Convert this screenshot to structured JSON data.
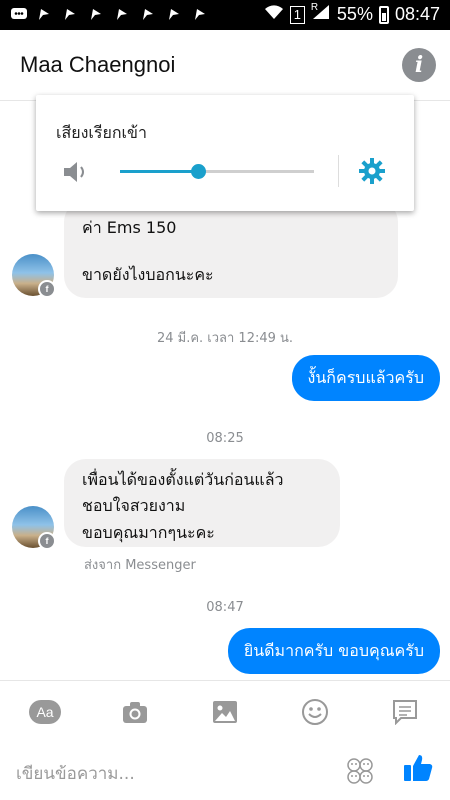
{
  "status_bar": {
    "battery": "55%",
    "time": "08:47",
    "sim_label": "1",
    "roaming": "R"
  },
  "header": {
    "title": "Maa Chaengnoi",
    "info_icon": "info-icon"
  },
  "volume_panel": {
    "title": "เสียงเรียกเข้า",
    "level_fraction": 0.4,
    "accent": "#1aa0cc"
  },
  "messages": [
    {
      "lines": [
        "ค่า Ems 150",
        "ขาดยังไงบอกนะคะ"
      ]
    },
    {
      "timestamp": "24 มี.ค. เวลา 12:49 น.",
      "text": "งั้นก็ครบแล้วครับ"
    },
    {
      "timestamp": "08:25",
      "lines": [
        "เพื่อนได้ของตั้งแต่วันก่อนแล้ว",
        "ชอบใจสวยงาม",
        "ขอบคุณมากๆนะคะ"
      ],
      "sub": "ส่งจาก Messenger"
    },
    {
      "timestamp": "08:47",
      "text": "ยินดีมากครับ ขอบคุณครับ"
    }
  ],
  "composer": {
    "aa_label": "Aa",
    "placeholder": "เขียนข้อความ..."
  },
  "colors": {
    "outgoing": "#0084ff",
    "incoming": "#f1f0f0",
    "muted": "#8a8d91"
  }
}
